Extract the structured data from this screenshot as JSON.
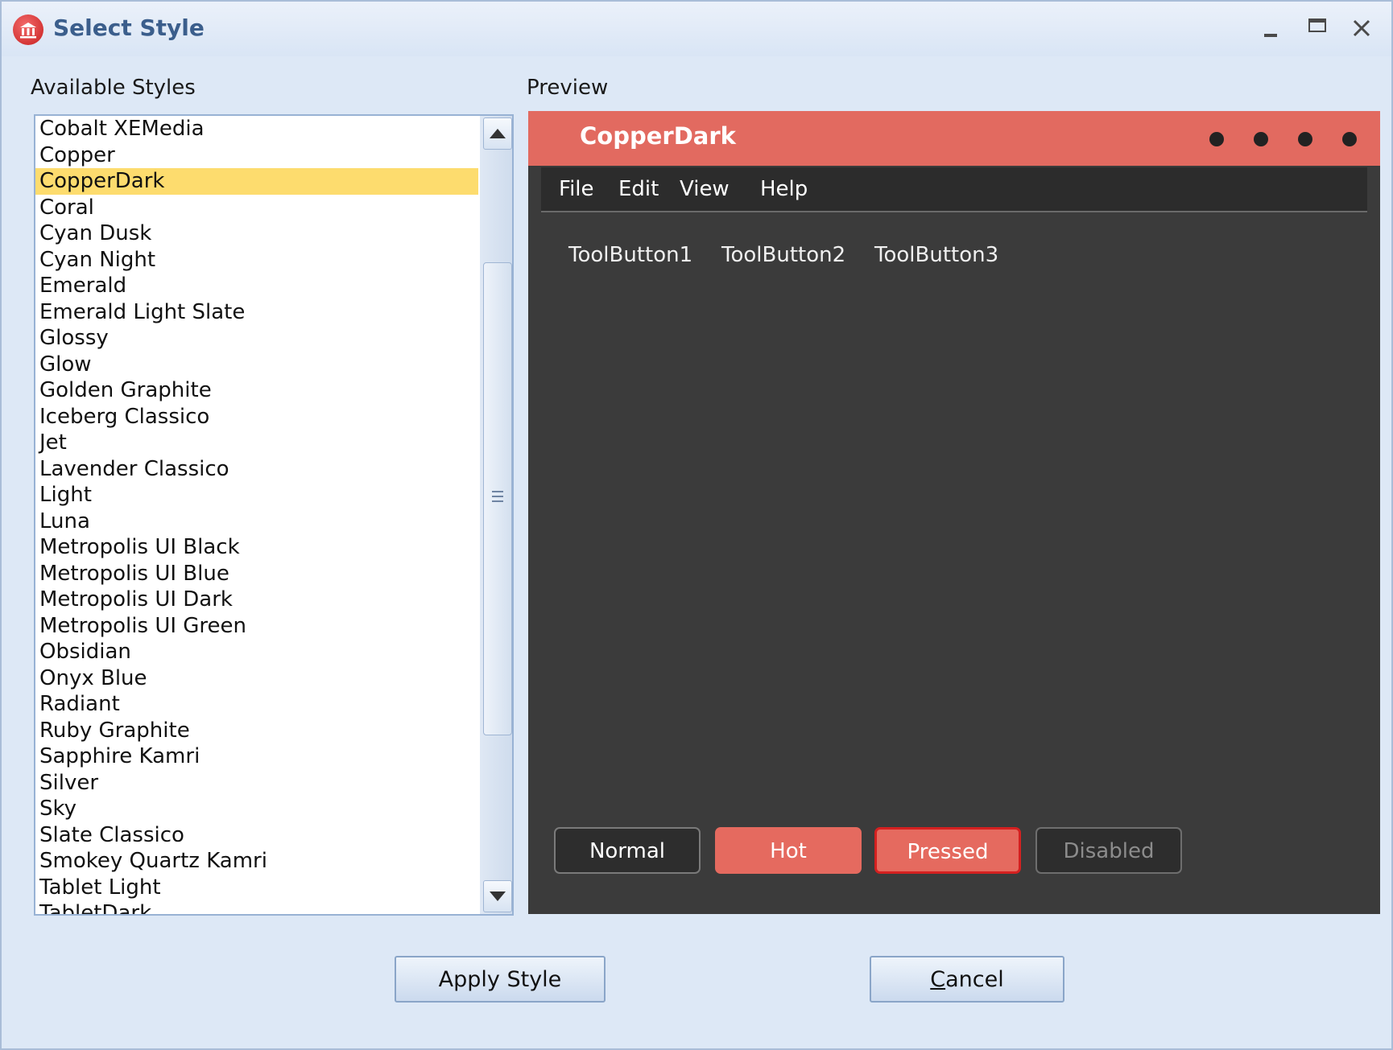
{
  "window": {
    "title": "Select Style"
  },
  "available_styles": {
    "label": "Available Styles",
    "selected_index": 2,
    "items": [
      "Cobalt XEMedia",
      "Copper",
      "CopperDark",
      "Coral",
      "Cyan Dusk",
      "Cyan Night",
      "Emerald",
      "Emerald Light Slate",
      "Glossy",
      "Glow",
      "Golden Graphite",
      "Iceberg Classico",
      "Jet",
      "Lavender Classico",
      "Light",
      "Luna",
      "Metropolis UI Black",
      "Metropolis UI Blue",
      "Metropolis UI Dark",
      "Metropolis UI Green",
      "Obsidian",
      "Onyx Blue",
      "Radiant",
      "Ruby Graphite",
      "Sapphire Kamri",
      "Silver",
      "Sky",
      "Slate Classico",
      "Smokey Quartz Kamri",
      "Tablet Light",
      "TabletDark"
    ]
  },
  "preview": {
    "label": "Preview",
    "title": "CopperDark",
    "title_color": "#e26a60",
    "menu": [
      "File",
      "Edit",
      "View",
      "Help"
    ],
    "tool_buttons": [
      "ToolButton1",
      "ToolButton2",
      "ToolButton3"
    ],
    "state_buttons": {
      "normal": "Normal",
      "hot": "Hot",
      "pressed": "Pressed",
      "disabled": "Disabled"
    }
  },
  "buttons": {
    "apply": "Apply Style",
    "cancel_rest": "ancel",
    "cancel_accel": "C"
  }
}
